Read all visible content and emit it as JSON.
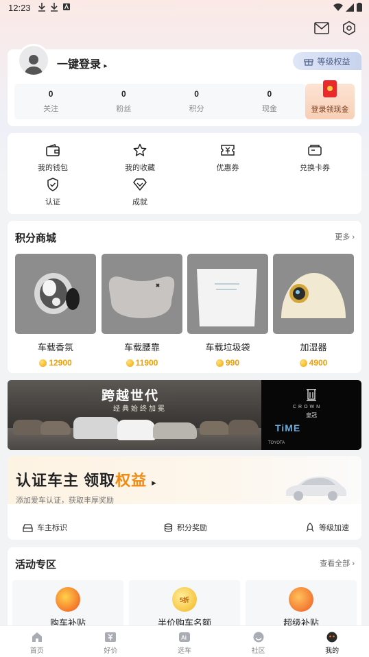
{
  "status_bar": {
    "time": "12:23"
  },
  "profile": {
    "login_label": "一键登录",
    "level_tag": "等级权益",
    "stats": [
      {
        "value": "0",
        "label": "关注"
      },
      {
        "value": "0",
        "label": "粉丝"
      },
      {
        "value": "0",
        "label": "积分"
      },
      {
        "value": "0",
        "label": "现金"
      }
    ],
    "cash_label": "登录领现金"
  },
  "tools": [
    {
      "label": "我的钱包",
      "icon": "wallet-icon"
    },
    {
      "label": "我的收藏",
      "icon": "star-icon"
    },
    {
      "label": "优惠券",
      "icon": "coupon-icon"
    },
    {
      "label": "兑换卡券",
      "icon": "card-icon"
    },
    {
      "label": "认证",
      "icon": "shield-check-icon"
    },
    {
      "label": "成就",
      "icon": "diamond-icon"
    }
  ],
  "mall": {
    "title": "积分商城",
    "more": "更多",
    "products": [
      {
        "name": "车载香氛",
        "price": "12900"
      },
      {
        "name": "车载腰靠",
        "price": "11900"
      },
      {
        "name": "车载垃圾袋",
        "price": "990"
      },
      {
        "name": "加湿器",
        "price": "4900"
      }
    ]
  },
  "banner": {
    "title": "跨越世代",
    "subtitle": "经典始终加冕",
    "crown_en": "CROWN",
    "crown_cn": "皇冠",
    "time_text": "TiME",
    "brand": "TOYOTA"
  },
  "certify": {
    "title_part1": "认证车主",
    "title_part2": "领取",
    "title_highlight": "权益",
    "desc": "添加爱车认证，获取丰厚奖励",
    "perks": [
      "车主标识",
      "积分奖励",
      "等级加速"
    ]
  },
  "activity": {
    "title": "活动专区",
    "more": "查看全部",
    "items": [
      {
        "label": "购车补贴"
      },
      {
        "label": "半价购车名额",
        "badge": "5折"
      },
      {
        "label": "超级补贴"
      }
    ]
  },
  "tabbar": [
    {
      "label": "首页",
      "icon": "home-icon"
    },
    {
      "label": "好价",
      "icon": "price-tag-icon"
    },
    {
      "label": "选车",
      "icon": "ai-car-icon"
    },
    {
      "label": "社区",
      "icon": "community-icon"
    },
    {
      "label": "我的",
      "icon": "profile-icon",
      "active": true
    }
  ],
  "colors": {
    "accent_orange": "#f28a12",
    "coin_gold": "#f0a000",
    "redpack": "#ea2a2a"
  }
}
